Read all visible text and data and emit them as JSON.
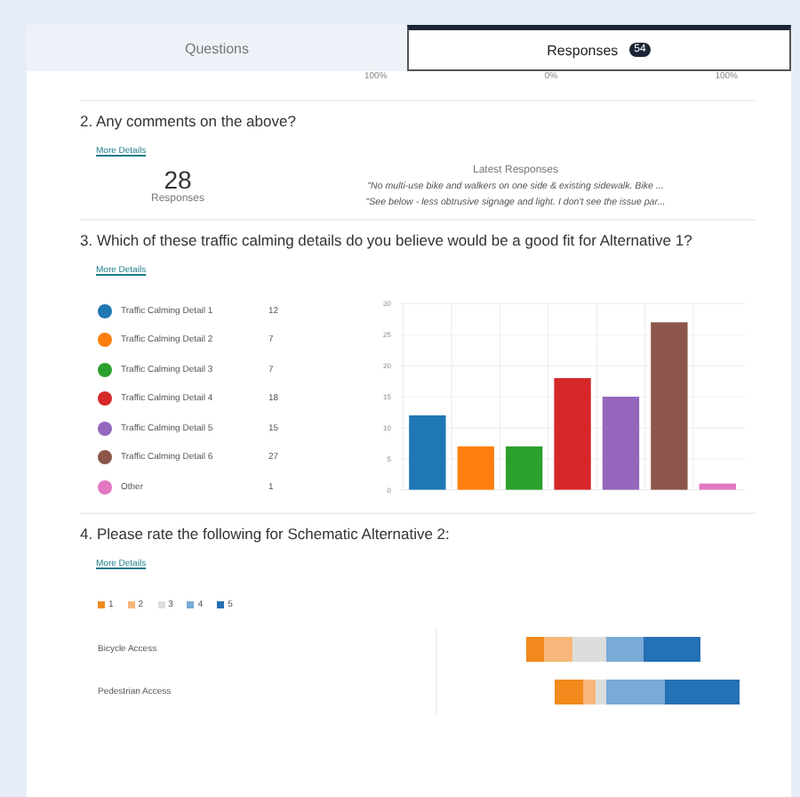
{
  "tabs": [
    {
      "label": "Questions",
      "selected": false
    },
    {
      "label": "Responses",
      "selected": true,
      "badge": "54"
    }
  ],
  "previous_axis": [
    "100%",
    "0%",
    "100%"
  ],
  "q2": {
    "title": "2.  Any comments on the above?",
    "link": "More Details",
    "count": "28",
    "count_label": "Responses",
    "latest_title": "Latest Responses",
    "latest": [
      "\"No multi-use bike and walkers on one side & existing sidewalk. Bike ...",
      "\"See below - less obtrusive signage and light. I don't see the issue par..."
    ]
  },
  "q3": {
    "title": "3.  Which of these traffic calming details do you believe would be a good fit for Alternative 1?",
    "link": "More Details",
    "legend": [
      {
        "label": "Traffic Calming Detail 1",
        "count": "12",
        "color": "#1f77b4"
      },
      {
        "label": "Traffic Calming Detail 2",
        "count": "7",
        "color": "#ff7f0e"
      },
      {
        "label": "Traffic Calming Detail 3",
        "count": "7",
        "color": "#2ca02c"
      },
      {
        "label": "Traffic Calming Detail 4",
        "count": "18",
        "color": "#d62728"
      },
      {
        "label": "Traffic Calming Detail 5",
        "count": "15",
        "color": "#9467bd"
      },
      {
        "label": "Traffic Calming Detail 6",
        "count": "27",
        "color": "#8c564b"
      },
      {
        "label": "Other",
        "count": "1",
        "color": "#e377c2"
      }
    ],
    "chart_data": {
      "type": "bar",
      "values": [
        12,
        7,
        7,
        18,
        15,
        27,
        1
      ],
      "ylim": [
        0,
        30
      ],
      "yticks": [
        0,
        5,
        10,
        15,
        20,
        25,
        30
      ],
      "grid": true
    }
  },
  "q4": {
    "title": "4.  Please rate the following for Schematic Alternative 2:",
    "link": "More Details",
    "legend": [
      {
        "label": "1",
        "color": "#f28a1e"
      },
      {
        "label": "2",
        "color": "#f7b77a"
      },
      {
        "label": "3",
        "color": "#dddddd"
      },
      {
        "label": "4",
        "color": "#7aaad6"
      },
      {
        "label": "5",
        "color": "#2571b5"
      }
    ],
    "rows": [
      {
        "label": "Bicycle Access"
      },
      {
        "label": "Pedestrian Access"
      }
    ]
  }
}
